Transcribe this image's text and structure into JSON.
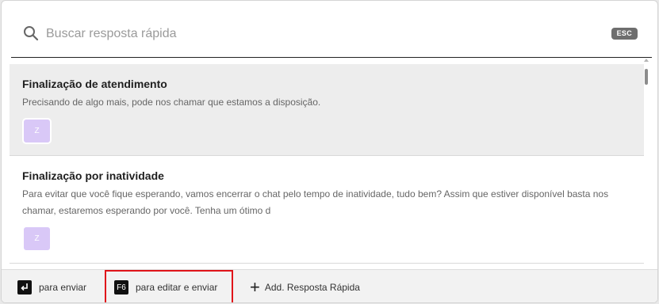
{
  "search": {
    "placeholder": "Buscar resposta rápida",
    "esc_label": "ESC"
  },
  "items": [
    {
      "title": "Finalização de atendimento",
      "text": "Precisando de algo mais, pode nos chamar que estamos a disposição.",
      "tag": "Z"
    },
    {
      "title": "Finalização por inatividade",
      "text": "Para evitar que você fique esperando, vamos encerrar o chat pelo tempo de inatividade, tudo bem? Assim que estiver disponível basta nos chamar, estaremos esperando por você. Tenha um ótimo d",
      "tag": "Z"
    }
  ],
  "footer": {
    "send_label": "para enviar",
    "f6_key": "F6",
    "edit_send_label": "para editar e enviar",
    "add_label": "Add. Resposta Rápida"
  },
  "colors": {
    "tag_bg": "#d9c8f7",
    "highlight_border": "#e0141a",
    "esc_bg": "#6e6e6e"
  }
}
